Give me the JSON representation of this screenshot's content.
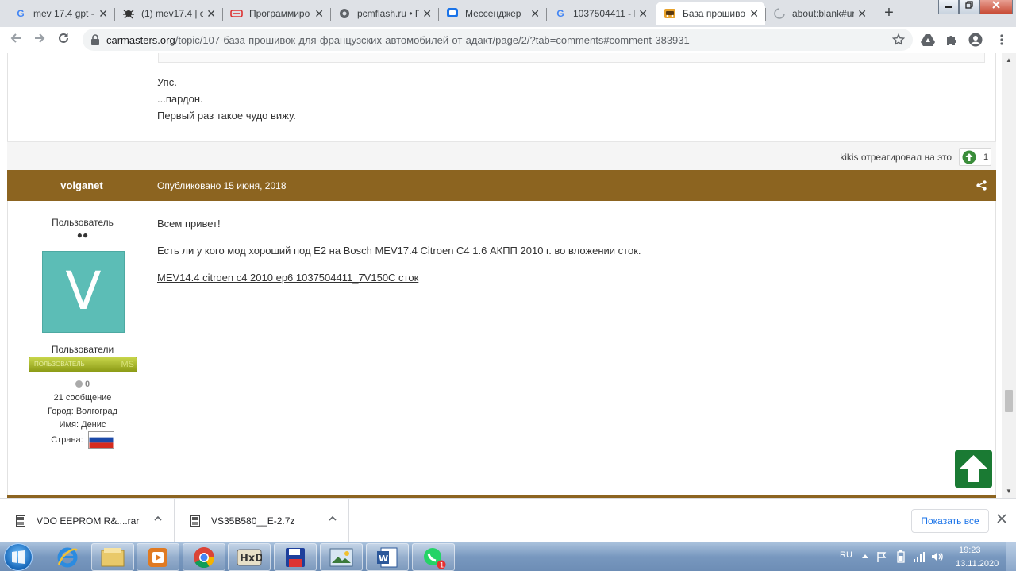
{
  "browser": {
    "tabs": [
      {
        "title": "mev 17.4 gpt -",
        "icon": "google-icon",
        "active": false
      },
      {
        "title": "(1) mev17.4 | of",
        "icon": "bug-icon",
        "active": false
      },
      {
        "title": "Программиро",
        "icon": "programmer-site-icon",
        "active": false
      },
      {
        "title": "pcmflash.ru • П",
        "icon": "globe-icon",
        "active": false
      },
      {
        "title": "Мессенджер",
        "icon": "messenger-icon",
        "active": false
      },
      {
        "title": "1037504411 - I",
        "icon": "google-icon",
        "active": false
      },
      {
        "title": "База прошиво",
        "icon": "car-icon",
        "active": true
      },
      {
        "title": "about:blank#ur",
        "icon": "loading-icon",
        "active": false
      }
    ],
    "close_glyph": "✕",
    "new_tab_glyph": "+",
    "url_host": "carmasters.org",
    "url_path": "/topic/107-база-прошивок-для-французских-автомобилей-от-адакт/page/2/?tab=comments#comment-383931"
  },
  "prev_post": {
    "lines": [
      "Упс.",
      "...пардон.",
      "Первый раз такое чудо вижу."
    ],
    "reaction_text": "kikis отреагировал на это",
    "reaction_count": "1"
  },
  "post": {
    "author": "volganet",
    "date": "Опубликовано 15 июня, 2018",
    "author_title": "Пользователь",
    "rank_dots": "●●",
    "avatar_letter": "V",
    "group": "Пользователи",
    "group_badge_label": "ПОЛЬЗОВАТЕЛЬ",
    "group_badge_tag": "MS",
    "reputation": "0",
    "stats": {
      "posts": "21 сообщение",
      "city": "Город: Волгоград",
      "name": "Имя: Денис",
      "country_label": "Страна:"
    },
    "body": [
      "Всем привет!",
      "Есть ли у кого мод хороший под Е2 на Bosch MEV17.4 Citroen C4 1.6 АКПП 2010 г. во вложении сток."
    ],
    "attachment_link": "MEV14.4 citroen c4 2010 ep6 1037504411_7V150C сток"
  },
  "downloads": {
    "items": [
      "VDO EEPROM R&....rar",
      "VS35B580__E-2.7z"
    ],
    "show_all": "Показать все"
  },
  "taskbar": {
    "language": "RU",
    "time": "19:23",
    "date": "13.11.2020",
    "whatsapp_badge": "1"
  }
}
